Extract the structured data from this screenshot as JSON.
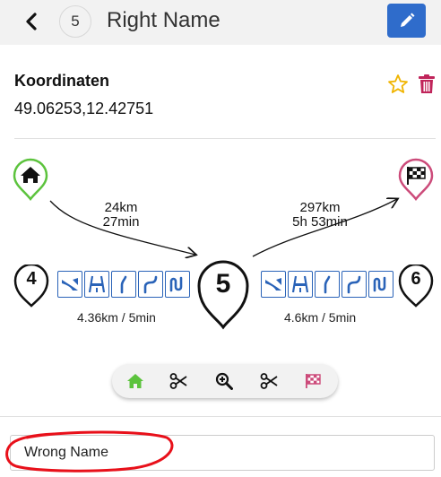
{
  "header": {
    "back_icon": "chevron-left-icon",
    "waypoint_number": "5",
    "title": "Right Name",
    "edit_icon": "pencil-icon",
    "accent_color": "#2f6ccb"
  },
  "details": {
    "coords_label": "Koordinaten",
    "coords_value": "49.06253,12.42751",
    "favorite_icon": "star-icon",
    "delete_icon": "trash-icon"
  },
  "route": {
    "start_icon": "home-icon",
    "finish_icon": "checkered-flag-icon",
    "from_start": {
      "distance": "24km",
      "time": "27min"
    },
    "to_finish": {
      "distance": "297km",
      "time": "5h 53min"
    },
    "prev": {
      "number": "4",
      "segment": "4.36km / 5min",
      "maneuvers": [
        "ramp-icon",
        "motorway-icon",
        "slight-left-icon",
        "turn-left-icon",
        "u-turn-icon"
      ]
    },
    "current": {
      "number": "5"
    },
    "next": {
      "number": "6",
      "segment": "4.6km / 5min",
      "maneuvers": [
        "ramp-icon",
        "motorway-icon",
        "slight-left-icon",
        "turn-left-icon",
        "u-turn-icon"
      ]
    }
  },
  "toolbar": {
    "items": [
      "home-icon",
      "scissors-icon",
      "zoom-in-icon",
      "scissors-icon",
      "flag-icon"
    ]
  },
  "name_input": {
    "value": "Wrong Name"
  }
}
